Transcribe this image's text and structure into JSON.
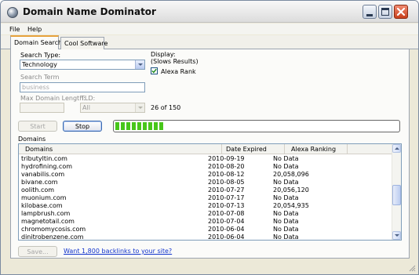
{
  "window": {
    "title": "Domain Name Dominator"
  },
  "menu": {
    "items": [
      "File",
      "Help"
    ]
  },
  "tabs": {
    "items": [
      {
        "label": "Domain Search",
        "active": true
      },
      {
        "label": "Cool Software",
        "active": false
      }
    ]
  },
  "search": {
    "type_label": "Search Type:",
    "type_value": "Technology",
    "term_label": "Search Term",
    "term_placeholder": "business",
    "max_length_label": "Max Domain Length:",
    "tld_label": "TLD:",
    "tld_value": "All",
    "count_text": "26 of 150"
  },
  "display": {
    "label": "Display:",
    "note": "(Slows Results)",
    "alexa_label": "Alexa Rank",
    "alexa_checked": true
  },
  "controls": {
    "start_label": "Start",
    "stop_label": "Stop",
    "progress_fraction": 0.17
  },
  "domains": {
    "section_label": "Domains",
    "columns": [
      "Domains",
      "Date Expired",
      "Alexa Ranking"
    ],
    "rows": [
      [
        "tributyltin.com",
        "2010-09-19",
        "No Data"
      ],
      [
        "hydrofining.com",
        "2010-08-20",
        "No Data"
      ],
      [
        "vanabilis.com",
        "2010-08-12",
        "20,058,096"
      ],
      [
        "bivane.com",
        "2010-08-05",
        "No Data"
      ],
      [
        "oolith.com",
        "2010-07-27",
        "20,056,120"
      ],
      [
        "muonium.com",
        "2010-07-17",
        "No Data"
      ],
      [
        "kilobase.com",
        "2010-07-13",
        "20,054,935"
      ],
      [
        "lampbrush.com",
        "2010-07-08",
        "No Data"
      ],
      [
        "magnetotail.com",
        "2010-07-04",
        "No Data"
      ],
      [
        "chromomycosis.com",
        "2010-06-04",
        "No Data"
      ],
      [
        "dinitrobenzene.com",
        "2010-06-04",
        "No Data"
      ]
    ]
  },
  "footer": {
    "save_label": "Save...",
    "link_text": "Want 1,800 backlinks to your site?"
  },
  "colors": {
    "progress_green": "#47c61a",
    "link_blue": "#1133cc",
    "tab_accent": "#e6a23c",
    "close_red": "#c8401c"
  },
  "icons": [
    "app-globe-icon",
    "minimize-icon",
    "maximize-icon",
    "close-icon",
    "checkmark-icon",
    "chevron-down-icon",
    "scroll-up-icon",
    "scroll-down-icon",
    "resize-grip-icon"
  ]
}
